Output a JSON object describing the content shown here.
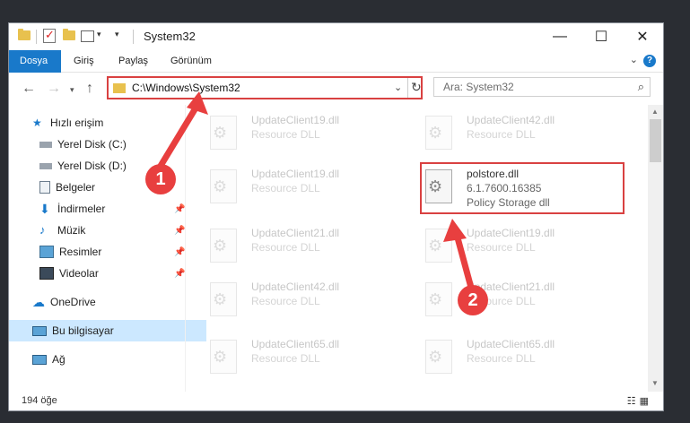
{
  "window": {
    "title": "System32"
  },
  "ribbon": {
    "tabs": [
      "Dosya",
      "Giriş",
      "Paylaş",
      "Görünüm"
    ],
    "help": "?"
  },
  "address": {
    "path": "C:\\Windows\\System32"
  },
  "search": {
    "placeholder": "Ara: System32"
  },
  "sidebar": {
    "items": [
      {
        "label": "Hızlı erişim",
        "icon": "star-icon"
      },
      {
        "label": "Yerel Disk (C:)",
        "icon": "drive-icon"
      },
      {
        "label": "Yerel Disk (D:)",
        "icon": "drive-icon"
      },
      {
        "label": "Belgeler",
        "icon": "documents-icon"
      },
      {
        "label": "İndirmeler",
        "icon": "download-icon"
      },
      {
        "label": "Müzik",
        "icon": "music-icon"
      },
      {
        "label": "Resimler",
        "icon": "pictures-icon"
      },
      {
        "label": "Videolar",
        "icon": "videos-icon"
      },
      {
        "label": "OneDrive",
        "icon": "cloud-icon"
      },
      {
        "label": "Bu bilgisayar",
        "icon": "computer-icon"
      },
      {
        "label": "Ağ",
        "icon": "network-icon"
      }
    ]
  },
  "files": [
    {
      "name": "UpdateClient19.dll",
      "line2": "Resource DLL",
      "line3": ""
    },
    {
      "name": "UpdateClient42.dll",
      "line2": "Resource DLL",
      "line3": ""
    },
    {
      "name": "UpdateClient19.dll",
      "line2": "Resource DLL",
      "line3": ""
    },
    {
      "name": "polstore.dll",
      "line2": "6.1.7600.16385",
      "line3": "Policy Storage dll"
    },
    {
      "name": "UpdateClient21.dll",
      "line2": "Resource DLL",
      "line3": ""
    },
    {
      "name": "UpdateClient19.dll",
      "line2": "Resource DLL",
      "line3": ""
    },
    {
      "name": "UpdateClient42.dll",
      "line2": "Resource DLL",
      "line3": ""
    },
    {
      "name": "UpdateClient21.dll",
      "line2": "Resource DLL",
      "line3": ""
    },
    {
      "name": "UpdateClient65.dll",
      "line2": "Resource DLL",
      "line3": ""
    },
    {
      "name": "UpdateClient65.dll",
      "line2": "Resource DLL",
      "line3": ""
    }
  ],
  "status": {
    "count": "194 öğe"
  },
  "annotations": {
    "badge1": "1",
    "badge2": "2"
  },
  "colors": {
    "accent": "#1979ca",
    "highlight": "#d94141"
  }
}
